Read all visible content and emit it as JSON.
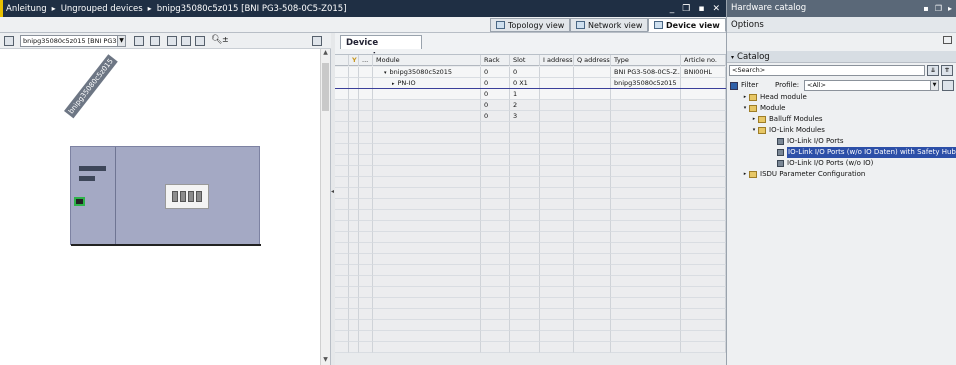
{
  "titlebar": {
    "crumbs": [
      "Anleitung",
      "Ungrouped devices",
      "bnipg35080c5z015 [BNI PG3-508-0C5-Z015]"
    ],
    "sep": "▸",
    "buttons": [
      "_",
      "❐",
      "▪",
      "✕"
    ]
  },
  "view_tabs": [
    {
      "label": "Topology view",
      "active": false
    },
    {
      "label": "Network view",
      "active": false
    },
    {
      "label": "Device view",
      "active": true
    }
  ],
  "left_toolbar": {
    "device_select": "bnipg35080c5z015 [BNI PG3-5"
  },
  "canvas": {
    "rack_label": "bnipg35080c5z015"
  },
  "device_overview": {
    "tab_label": "Device overview",
    "columns": [
      "",
      "",
      "",
      "Module",
      "Rack",
      "Slot",
      "I address",
      "Q address",
      "Type",
      "Article no."
    ],
    "rows": [
      {
        "module": "bnipg35080c5z015",
        "indent": 1,
        "tri": "▾",
        "rack": "0",
        "slot": "0",
        "iaddr": "",
        "qaddr": "",
        "type": "BNI PG3-508-0C5-Z...",
        "article": "BNI00HL",
        "filled": true
      },
      {
        "module": "PN-IO",
        "indent": 2,
        "tri": "▸",
        "rack": "0",
        "slot": "0 X1",
        "iaddr": "",
        "qaddr": "",
        "type": "bnipg35080c5z015",
        "article": "",
        "filled": true
      },
      {
        "module": "",
        "indent": 0,
        "tri": "",
        "rack": "0",
        "slot": "1",
        "iaddr": "",
        "qaddr": "",
        "type": "",
        "article": "",
        "filled": false,
        "selected": true
      },
      {
        "module": "",
        "indent": 0,
        "tri": "",
        "rack": "0",
        "slot": "2",
        "iaddr": "",
        "qaddr": "",
        "type": "",
        "article": "",
        "filled": false
      },
      {
        "module": "",
        "indent": 0,
        "tri": "",
        "rack": "0",
        "slot": "3",
        "iaddr": "",
        "qaddr": "",
        "type": "",
        "article": "",
        "filled": false
      }
    ]
  },
  "catalog": {
    "pane_title": "Hardware catalog",
    "pane_buttons": [
      "▪",
      "❐",
      "▸"
    ],
    "options_label": "Options",
    "catalog_label": "Catalog",
    "search_placeholder": "<Search>",
    "filter_label": "Filter",
    "profile_label": "Profile:",
    "profile_value": "<All>",
    "tree": [
      {
        "label": "Head module",
        "level": 0,
        "kind": "folder",
        "tri": "▸"
      },
      {
        "label": "Module",
        "level": 0,
        "kind": "folder",
        "tri": "▾"
      },
      {
        "label": "Balluff Modules",
        "level": 1,
        "kind": "folder",
        "tri": "▸"
      },
      {
        "label": "IO-Link Modules",
        "level": 1,
        "kind": "folder",
        "tri": "▾"
      },
      {
        "label": "IO-Link I/O Ports",
        "level": 2,
        "kind": "module",
        "tri": ""
      },
      {
        "label": "IO-Link I/O Ports (w/o IO Daten) with Safety Hub and ISDU",
        "level": 2,
        "kind": "module",
        "tri": "",
        "highlight": true
      },
      {
        "label": "IO-Link I/O Ports (w/o IO)",
        "level": 2,
        "kind": "module",
        "tri": ""
      },
      {
        "label": "ISDU Parameter Configuration",
        "level": 0,
        "kind": "folder",
        "tri": "▸"
      }
    ]
  },
  "colors": {
    "titlebar_bg": "#1f2f44",
    "accent_edge": "#e8c000",
    "selection": "#2c4fa8",
    "port_green": "#2eb34a"
  }
}
